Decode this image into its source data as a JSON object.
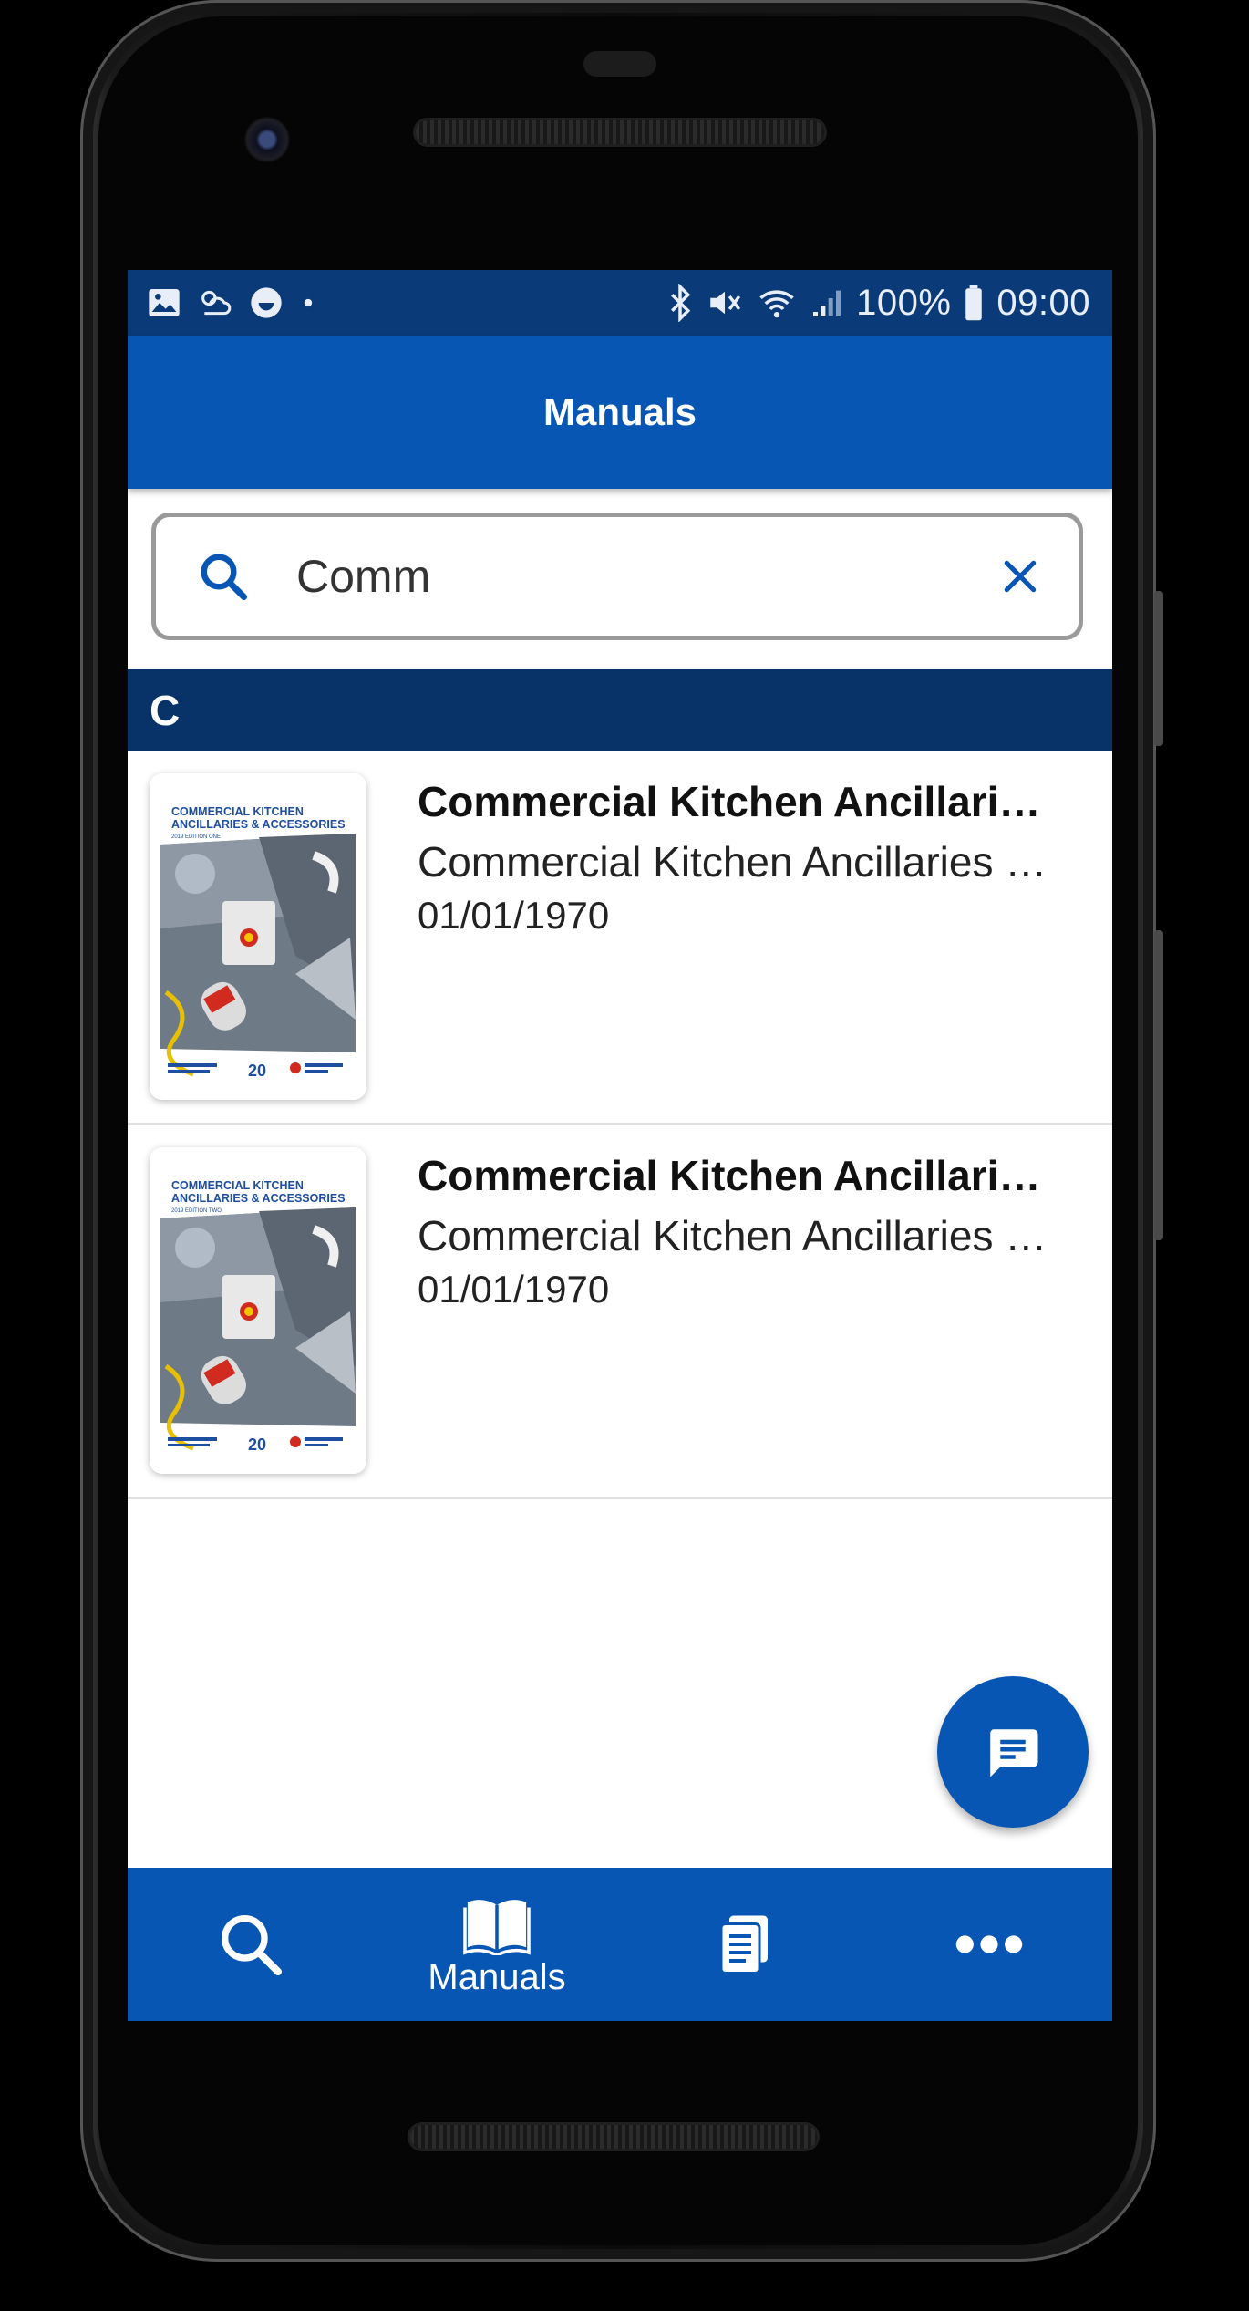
{
  "status_bar": {
    "battery": "100%",
    "time": "09:00",
    "left_icons": [
      "image-icon",
      "weather-icon",
      "face-icon",
      "dot-icon"
    ],
    "right_icons": [
      "bluetooth-icon",
      "mute-icon",
      "wifi-icon",
      "signal-icon",
      "battery-icon"
    ]
  },
  "app_bar": {
    "title": "Manuals"
  },
  "search": {
    "value": "Comm",
    "icon": "search-icon",
    "clear_icon": "close-icon"
  },
  "section": {
    "header": "C"
  },
  "results": [
    {
      "title": "Commercial Kitchen Ancillaries & Accessories",
      "subtitle": "Commercial Kitchen Ancillaries & Accessories",
      "date": "01/01/1970",
      "cover": {
        "line1": "COMMERCIAL KITCHEN",
        "line2": "ANCILLARIES & ACCESSORIES",
        "edition": "2019 EDITION ONE"
      }
    },
    {
      "title": "Commercial Kitchen Ancillaries & Accessories",
      "subtitle": "Commercial Kitchen Ancillaries & Accessories",
      "date": "01/01/1970",
      "cover": {
        "line1": "COMMERCIAL KITCHEN",
        "line2": "ANCILLARIES & ACCESSORIES",
        "edition": "2019 EDITION TWO"
      }
    }
  ],
  "fab": {
    "icon": "chat-icon"
  },
  "bottom_nav": {
    "items": [
      {
        "icon": "search-icon",
        "label": ""
      },
      {
        "icon": "book-icon",
        "label": "Manuals"
      },
      {
        "icon": "documents-icon",
        "label": ""
      },
      {
        "icon": "more-icon",
        "label": ""
      }
    ]
  },
  "colors": {
    "primary": "#0756b4",
    "status_bar": "#0a3a78",
    "section_header": "#083369"
  }
}
